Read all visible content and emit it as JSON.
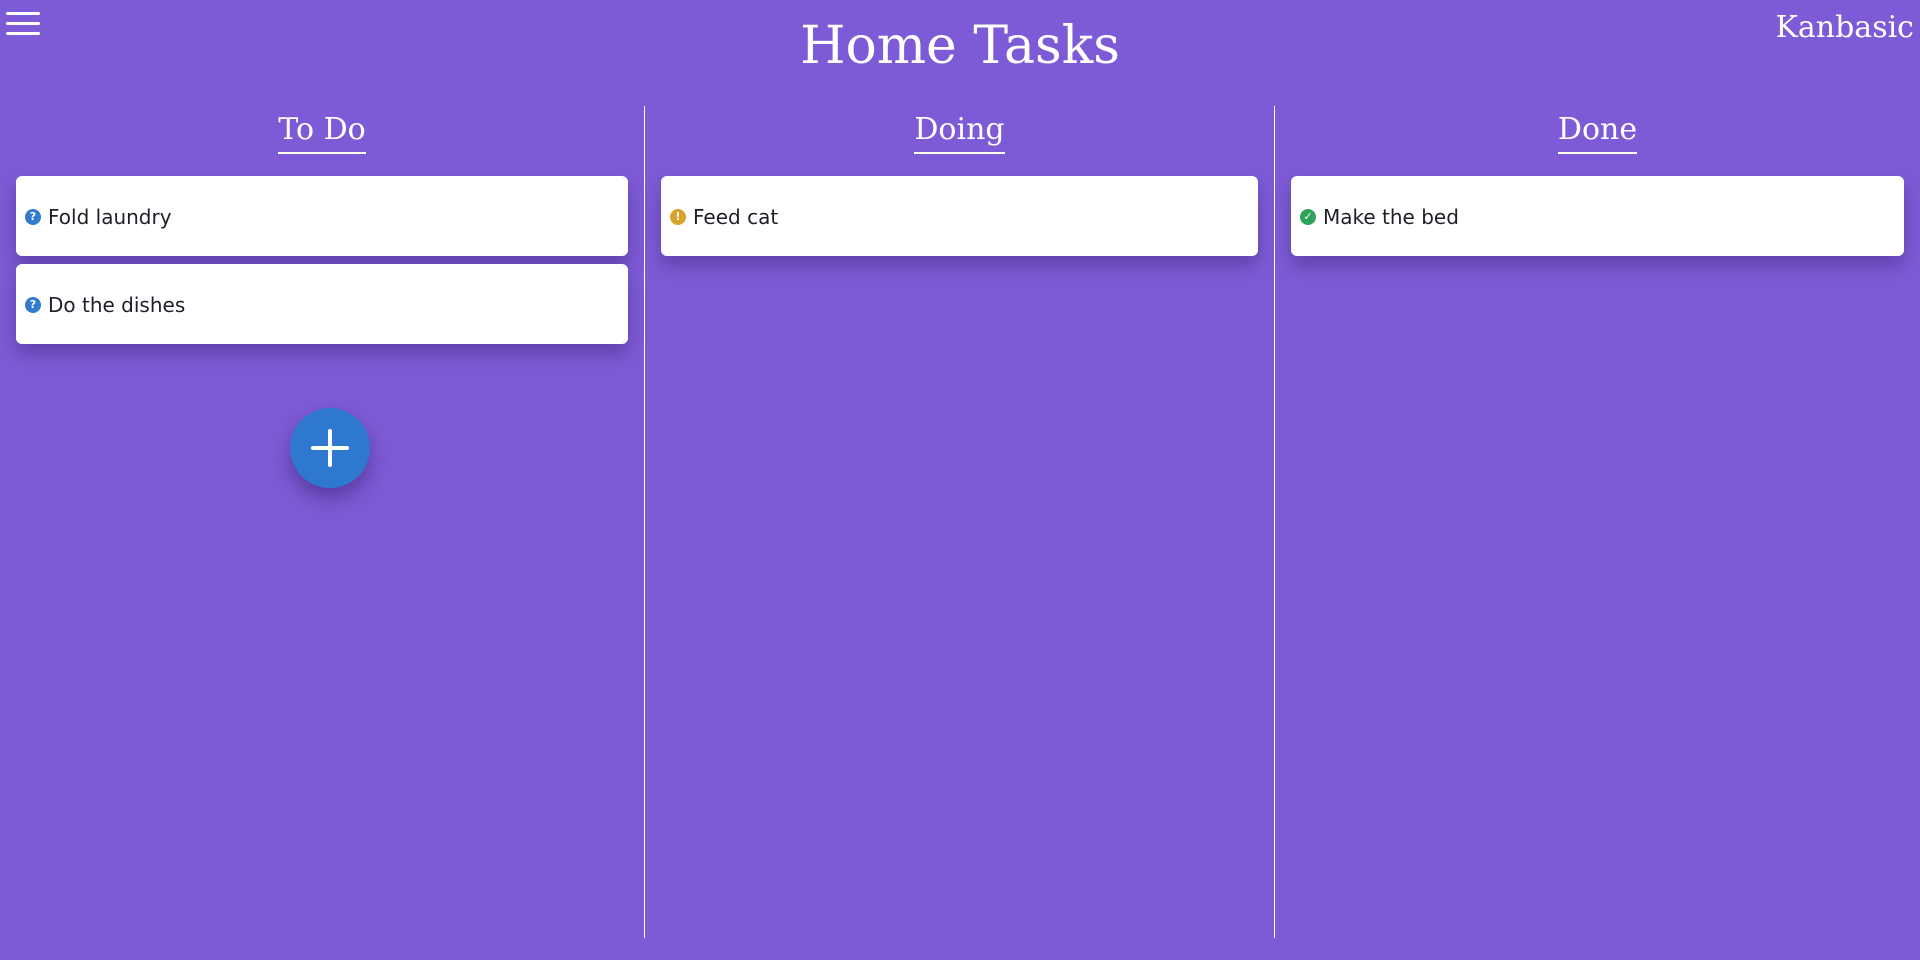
{
  "header": {
    "menu_icon": "hamburger-menu-icon",
    "title": "Home Tasks",
    "brand": "Kanbasic"
  },
  "columns": [
    {
      "title": "To Do",
      "cards": [
        {
          "text": "Fold laundry",
          "status_icon": "question-circle-icon",
          "status_glyph": "?"
        },
        {
          "text": "Do the dishes",
          "status_icon": "question-circle-icon",
          "status_glyph": "?"
        }
      ]
    },
    {
      "title": "Doing",
      "cards": [
        {
          "text": "Feed cat",
          "status_icon": "exclamation-circle-icon",
          "status_glyph": "!"
        }
      ]
    },
    {
      "title": "Done",
      "cards": [
        {
          "text": "Make the bed",
          "status_icon": "check-circle-icon",
          "status_glyph": "✓"
        }
      ]
    }
  ],
  "add_button": {
    "icon": "plus-icon"
  },
  "colors": {
    "background": "#7e5bd6",
    "todo_status": "#2f7ccf",
    "doing_status": "#d9a32a",
    "done_status": "#2ea35a",
    "add_button": "#2e79cf"
  }
}
